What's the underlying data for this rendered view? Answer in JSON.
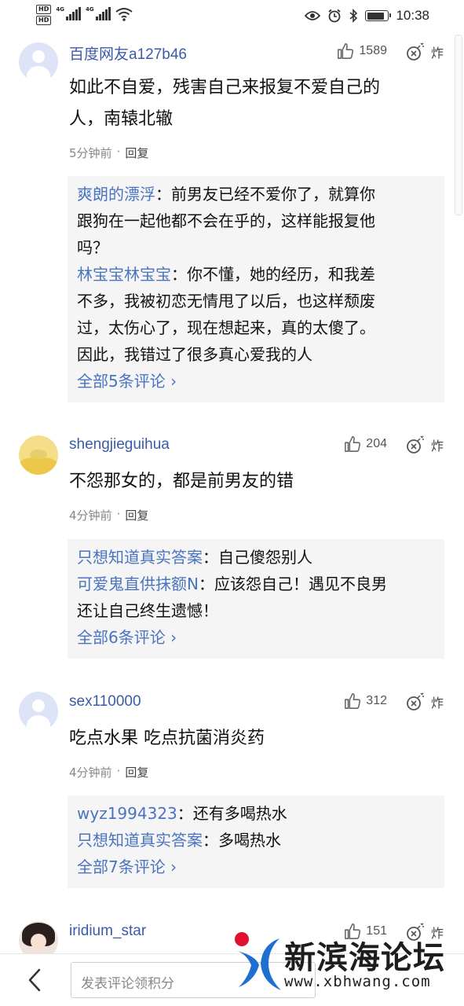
{
  "status_bar": {
    "hd1": "HD",
    "hd2": "HD",
    "net1": "4G",
    "net2": "4G",
    "time": "10:38",
    "battery_level": 0.85
  },
  "comments": [
    {
      "username": "百度网友a127b46",
      "likes": "1589",
      "bomb_label": "炸",
      "content": [
        "如此不自爱，残害自己来报复不爱自己的",
        "人，南辕北辙"
      ],
      "time": "5分钟前",
      "sep": "·",
      "reply_label": "回复",
      "replies": [
        {
          "user": "爽朗的漂浮",
          "text_lines": [
            "：前男友已经不爱你了，就算你",
            "跟狗在一起他都不会在乎的，这样能报复他",
            "吗？"
          ]
        },
        {
          "user": "林宝宝林宝宝",
          "text_lines": [
            "：你不懂，她的经历，和我差",
            "不多，我被初恋无情甩了以后，也这样颓废",
            "过，太伤心了，现在想起来，真的太傻了。",
            "因此，我错过了很多真心爱我的人"
          ]
        }
      ],
      "view_all": "全部5条评论 ›"
    },
    {
      "username": "shengjieguihua",
      "likes": "204",
      "bomb_label": "炸",
      "content": [
        "不怨那女的，都是前男友的错"
      ],
      "time": "4分钟前",
      "sep": "·",
      "reply_label": "回复",
      "replies": [
        {
          "user": "只想知道真实答案",
          "text_lines": [
            "：自己傻怨别人"
          ]
        },
        {
          "user": "可爱鬼直供抹额N",
          "text_lines": [
            "：应该怨自己！遇见不良男",
            "还让自己终生遗憾！"
          ]
        }
      ],
      "view_all": "全部6条评论 ›"
    },
    {
      "username": "sex110000",
      "likes": "312",
      "bomb_label": "炸",
      "content": [
        "吃点水果 吃点抗菌消炎药"
      ],
      "time": "4分钟前",
      "sep": "·",
      "reply_label": "回复",
      "replies": [
        {
          "user": "wyz1994323",
          "text_lines": [
            "：还有多喝热水"
          ]
        },
        {
          "user": "只想知道真实答案",
          "text_lines": [
            "：多喝热水"
          ]
        }
      ],
      "view_all": "全部7条评论 ›"
    },
    {
      "username": "iridium_star",
      "likes": "151",
      "bomb_label": "炸"
    }
  ],
  "bottom_bar": {
    "input_placeholder": "发表评论领积分"
  },
  "watermark": {
    "title": "新滨海论坛",
    "url": "www.xbhwang.com"
  },
  "colors": {
    "username": "#3b5ba8",
    "reply_user": "#4a74c0",
    "reply_bg": "#f5f5f5",
    "watermark_blue": "#1f6fd1",
    "watermark_red": "#e0102e"
  }
}
